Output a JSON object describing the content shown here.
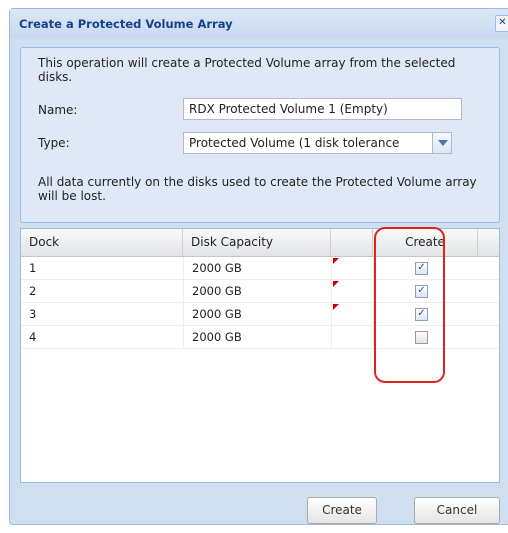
{
  "dialog": {
    "title": "Create a Protected Volume Array",
    "close_glyph": "✕",
    "description": "This operation will create a Protected Volume array from the selected disks.",
    "name_label": "Name:",
    "name_value": "RDX Protected Volume 1 (Empty)",
    "type_label": "Type:",
    "type_value": "Protected Volume (1 disk tolerance",
    "warning": "All data currently on the disks used to create the Protected Volume array will be lost."
  },
  "grid": {
    "columns": [
      "Dock",
      "Disk Capacity",
      "",
      "Create"
    ],
    "rows": [
      {
        "dock": "1",
        "capacity": "2000 GB",
        "create": true,
        "modified": true
      },
      {
        "dock": "2",
        "capacity": "2000 GB",
        "create": true,
        "modified": true
      },
      {
        "dock": "3",
        "capacity": "2000 GB",
        "create": true,
        "modified": true
      },
      {
        "dock": "4",
        "capacity": "2000 GB",
        "create": false,
        "modified": false
      }
    ]
  },
  "buttons": {
    "create": "Create",
    "cancel": "Cancel"
  },
  "colors": {
    "title": "#15428b",
    "frame": "#cfdff0",
    "highlight": "#e0241b"
  },
  "icons": {
    "close": "close-icon",
    "dropdown": "chevron-down-icon",
    "check": "checkbox-icon"
  }
}
